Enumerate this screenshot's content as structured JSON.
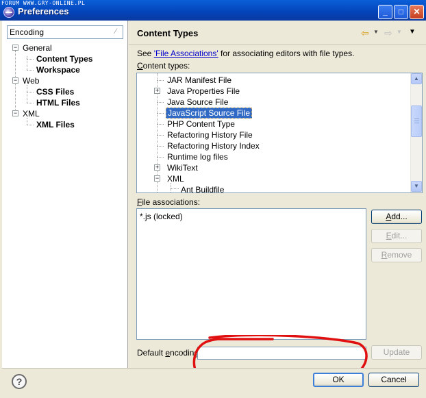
{
  "watermark": "FORUM WWW.GRY-ONLINE.PL",
  "window": {
    "title": "Preferences"
  },
  "filter": {
    "value": "Encoding"
  },
  "tree": {
    "general": "General",
    "content_types": "Content Types",
    "workspace": "Workspace",
    "web": "Web",
    "css_files": "CSS Files",
    "html_files": "HTML Files",
    "xml": "XML",
    "xml_files": "XML Files"
  },
  "page": {
    "title": "Content Types",
    "see_prefix": "See ",
    "see_link": "'File Associations'",
    "see_suffix": " for associating editors with file types.",
    "content_types_label_u": "C",
    "content_types_label_rest": "ontent types:",
    "file_assoc_label_u": "F",
    "file_assoc_label_rest": "ile associations:",
    "default_encoding_label_a": "Default ",
    "default_encoding_label_u": "e",
    "default_encoding_label_b": "ncoding:"
  },
  "content_types": [
    "JAR Manifest File",
    "Java Properties File",
    "Java Source File",
    "JavaScript Source File",
    "PHP Content Type",
    "Refactoring History File",
    "Refactoring History Index",
    "Runtime log files",
    "WikiText",
    "XML",
    "Ant Buildfile"
  ],
  "file_associations": [
    "*.js (locked)"
  ],
  "buttons": {
    "add_u": "A",
    "add_rest": "dd...",
    "edit_u": "E",
    "edit_rest": "dit...",
    "remove_u": "R",
    "remove_rest": "emove",
    "update": "Update",
    "ok": "OK",
    "cancel": "Cancel"
  },
  "encoding": {
    "value": ""
  },
  "annotation": {
    "color": "#e01010"
  }
}
